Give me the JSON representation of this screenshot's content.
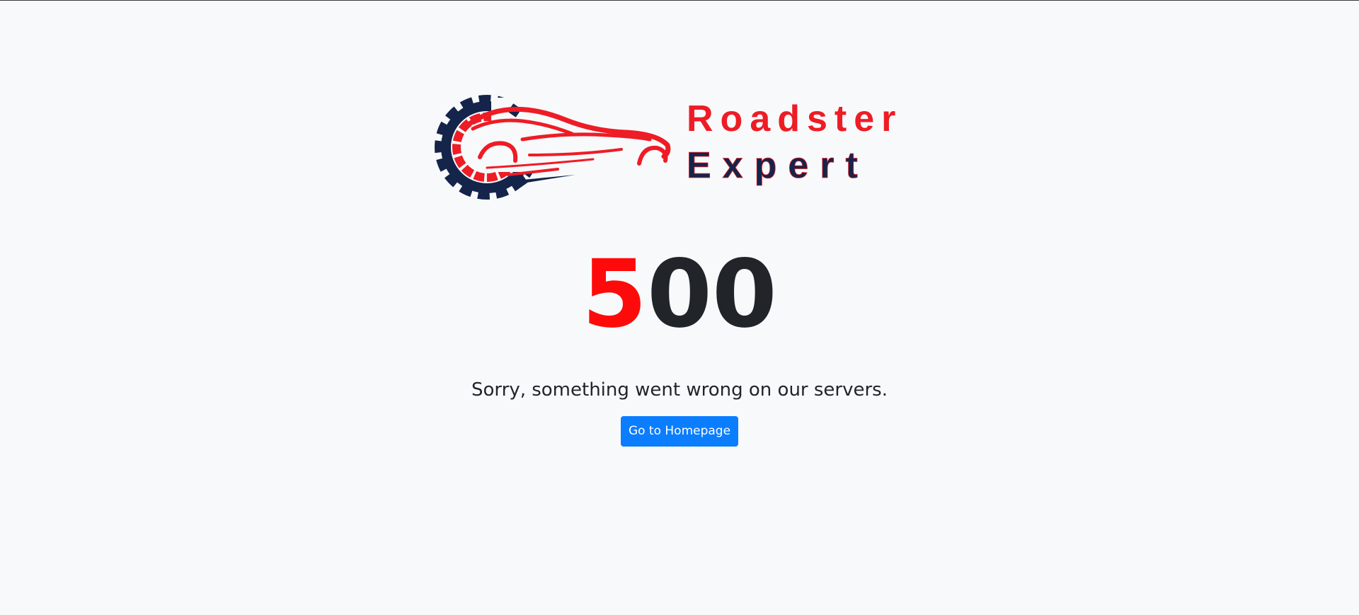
{
  "brand": {
    "name_line1": "Roadster",
    "name_line2": "Expert",
    "logo_icon": "gear-car-icon",
    "colors": {
      "red": "#ee1c25",
      "navy": "#14244a"
    }
  },
  "error": {
    "digit_1": "5",
    "digit_rest": "00",
    "message": "Sorry, something went wrong on our servers."
  },
  "actions": {
    "home_label": "Go to Homepage",
    "home_color": "#0b7dff"
  }
}
